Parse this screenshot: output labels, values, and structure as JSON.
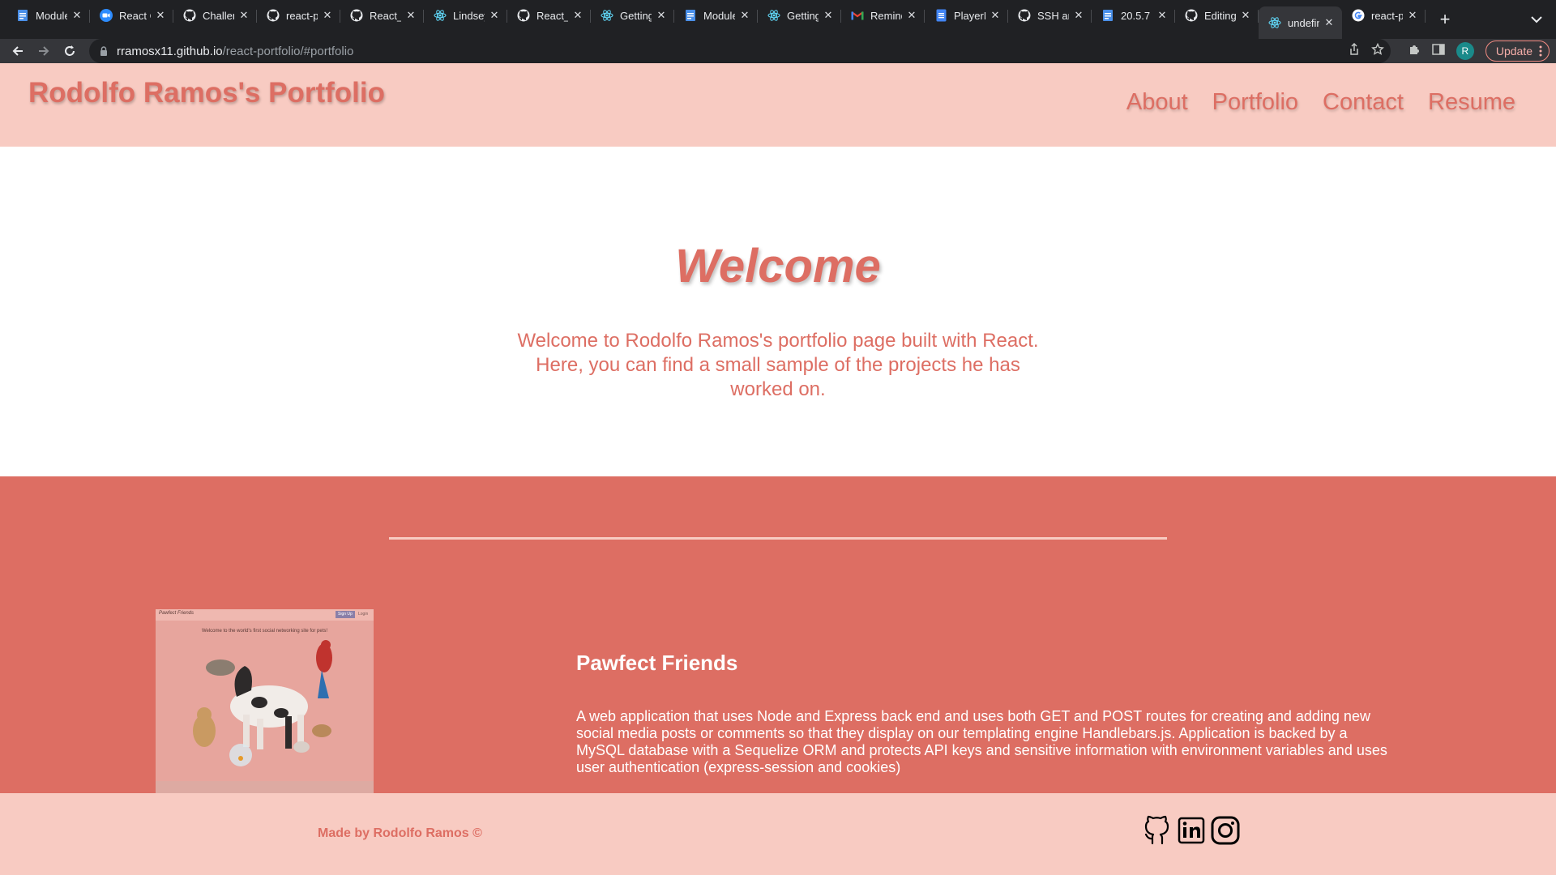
{
  "browser": {
    "tabs": [
      {
        "title": "Module",
        "favicon": "doc-icon",
        "active": false
      },
      {
        "title": "React C",
        "favicon": "zoom-icon",
        "active": false
      },
      {
        "title": "Challen",
        "favicon": "github-icon",
        "active": false
      },
      {
        "title": "react-p",
        "favicon": "github-icon",
        "active": false
      },
      {
        "title": "React_",
        "favicon": "github-icon",
        "active": false
      },
      {
        "title": "Lindsey",
        "favicon": "react-icon",
        "active": false
      },
      {
        "title": "React_",
        "favicon": "github-icon",
        "active": false
      },
      {
        "title": "Getting",
        "favicon": "react-icon",
        "active": false
      },
      {
        "title": "Module",
        "favicon": "doc-icon",
        "active": false
      },
      {
        "title": "Getting",
        "favicon": "react-icon",
        "active": false
      },
      {
        "title": "Remind",
        "favicon": "gmail-icon",
        "active": false
      },
      {
        "title": "PlayerL",
        "favicon": "docs-icon",
        "active": false
      },
      {
        "title": "SSH an",
        "favicon": "github-icon",
        "active": false
      },
      {
        "title": "20.5.7",
        "favicon": "doc-icon",
        "active": false
      },
      {
        "title": "Editing",
        "favicon": "github-icon",
        "active": false
      },
      {
        "title": "undefin",
        "favicon": "react-icon",
        "active": true
      },
      {
        "title": "react-p",
        "favicon": "google-icon",
        "active": false
      }
    ],
    "url_host": "rramosx11.github.io",
    "url_path": "/react-portfolio/#portfolio",
    "profile_initial": "R",
    "update_label": "Update",
    "colors": {
      "tab_bg": "#202124",
      "toolbar_bg": "#35363a",
      "update_border": "#f28b82"
    }
  },
  "site": {
    "title": "Rodolfo Ramos's Portfolio",
    "nav": [
      "About",
      "Portfolio",
      "Contact",
      "Resume"
    ],
    "hero_title": "Welcome",
    "hero_text": "Welcome to Rodolfo Ramos's portfolio page built with React. Here, you can find a small sample of the projects he has worked on.",
    "project": {
      "title": "Pawfect Friends",
      "description": "A web application that uses Node and Express back end and uses both GET and POST routes for creating and adding new social media posts or comments so that they display on our templating engine Handlebars.js. Application is backed by a MySQL database with a Sequelize ORM and protects API keys and sensitive information with environment variables and uses user authentication (express-session and cookies)",
      "thumb": {
        "logo": "Pawfect Friends",
        "signup": "Sign Up",
        "login": "Login",
        "tagline": "Welcome to the world's first social networking site for pets!"
      }
    },
    "footer_text": "Made by Rodolfo Ramos ©",
    "social": [
      "github-icon",
      "linkedin-icon",
      "instagram-icon"
    ],
    "colors": {
      "accent": "#dd6e63",
      "light": "#f8cbc2",
      "white": "#ffffff"
    }
  }
}
